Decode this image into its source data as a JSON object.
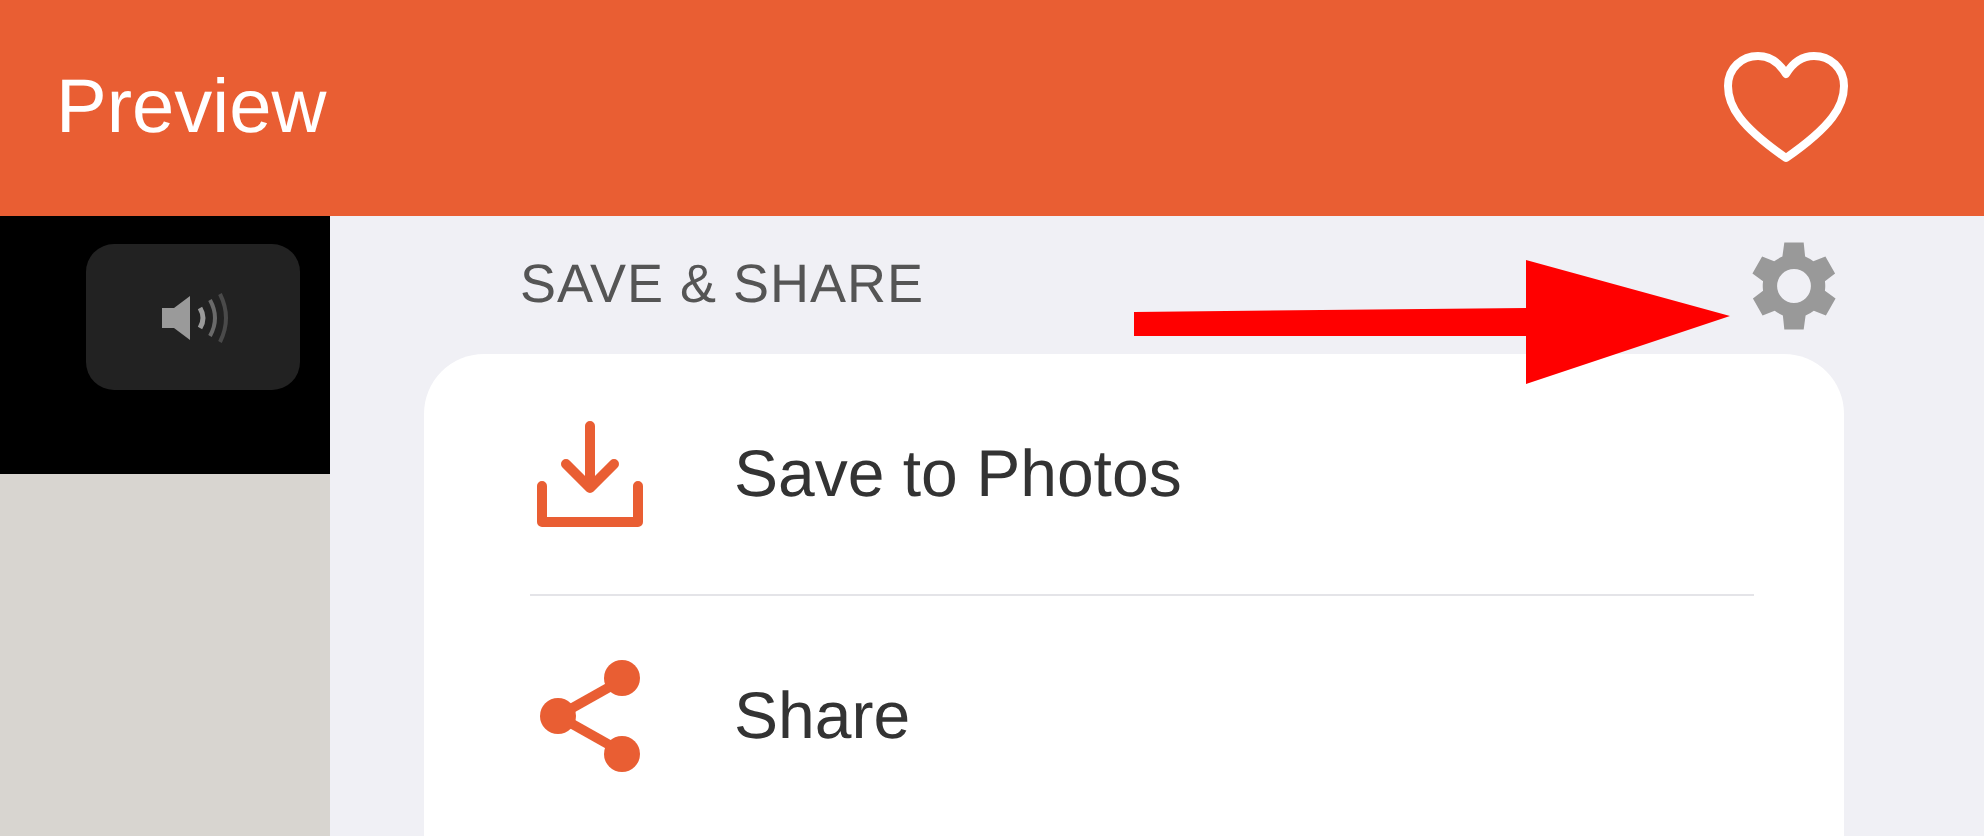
{
  "header": {
    "title": "Preview"
  },
  "section": {
    "title": "SAVE & SHARE"
  },
  "actions": [
    {
      "kind": "download",
      "label": "Save to Photos"
    },
    {
      "kind": "share",
      "label": "Share"
    }
  ]
}
